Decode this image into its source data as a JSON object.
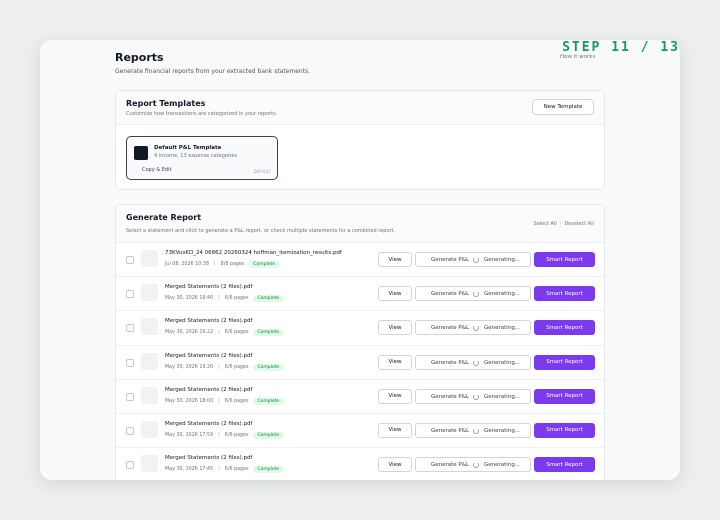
{
  "step_badge": "STEP 11 / 13",
  "page": {
    "title": "Reports",
    "subtitle": "Generate financial reports from your extracted bank statements.",
    "how_link": "How it works"
  },
  "templates": {
    "title": "Report Templates",
    "description": "Customize how transactions are categorized in your reports.",
    "new_button": "New Template",
    "items": [
      {
        "name": "Default P&L Template",
        "meta": "4 income, 13 expense categories",
        "action": "Copy & Edit",
        "badge": "DEFAULT"
      }
    ]
  },
  "generate": {
    "title": "Generate Report",
    "description": "Select a statement and click to generate a P&L report, or check multiple statements for a combined report.",
    "select_all": "Select All",
    "deselect_all": "Deselect All",
    "view_label": "View",
    "generate_label": "Generate P&L",
    "generating_label": "Generating...",
    "smart_label": "Smart Report",
    "rows": [
      {
        "name": "73KVusKD_24 06862 20260324 hoffman_itemization_results.pdf",
        "date": "Jul 08, 2026 10:38",
        "pages": "8/8 pages",
        "status": "Complete"
      },
      {
        "name": "Merged Statements (2 files).pdf",
        "date": "May 30, 2026 19:40",
        "pages": "6/6 pages",
        "status": "Complete"
      },
      {
        "name": "Merged Statements (2 files).pdf",
        "date": "May 30, 2026 19:22",
        "pages": "6/6 pages",
        "status": "Complete"
      },
      {
        "name": "Merged Statements (2 files).pdf",
        "date": "May 30, 2026 19:20",
        "pages": "6/6 pages",
        "status": "Complete"
      },
      {
        "name": "Merged Statements (2 files).pdf",
        "date": "May 30, 2026 18:00",
        "pages": "6/6 pages",
        "status": "Complete"
      },
      {
        "name": "Merged Statements (2 files).pdf",
        "date": "May 30, 2026 17:59",
        "pages": "6/6 pages",
        "status": "Complete"
      },
      {
        "name": "Merged Statements (2 files).pdf",
        "date": "May 30, 2026 17:45",
        "pages": "6/6 pages",
        "status": "Complete"
      }
    ]
  },
  "colors": {
    "accent_purple": "#7c3aed",
    "step_green": "#0f9b63",
    "status_green_bg": "#dcfce7",
    "status_green_text": "#15803d"
  }
}
